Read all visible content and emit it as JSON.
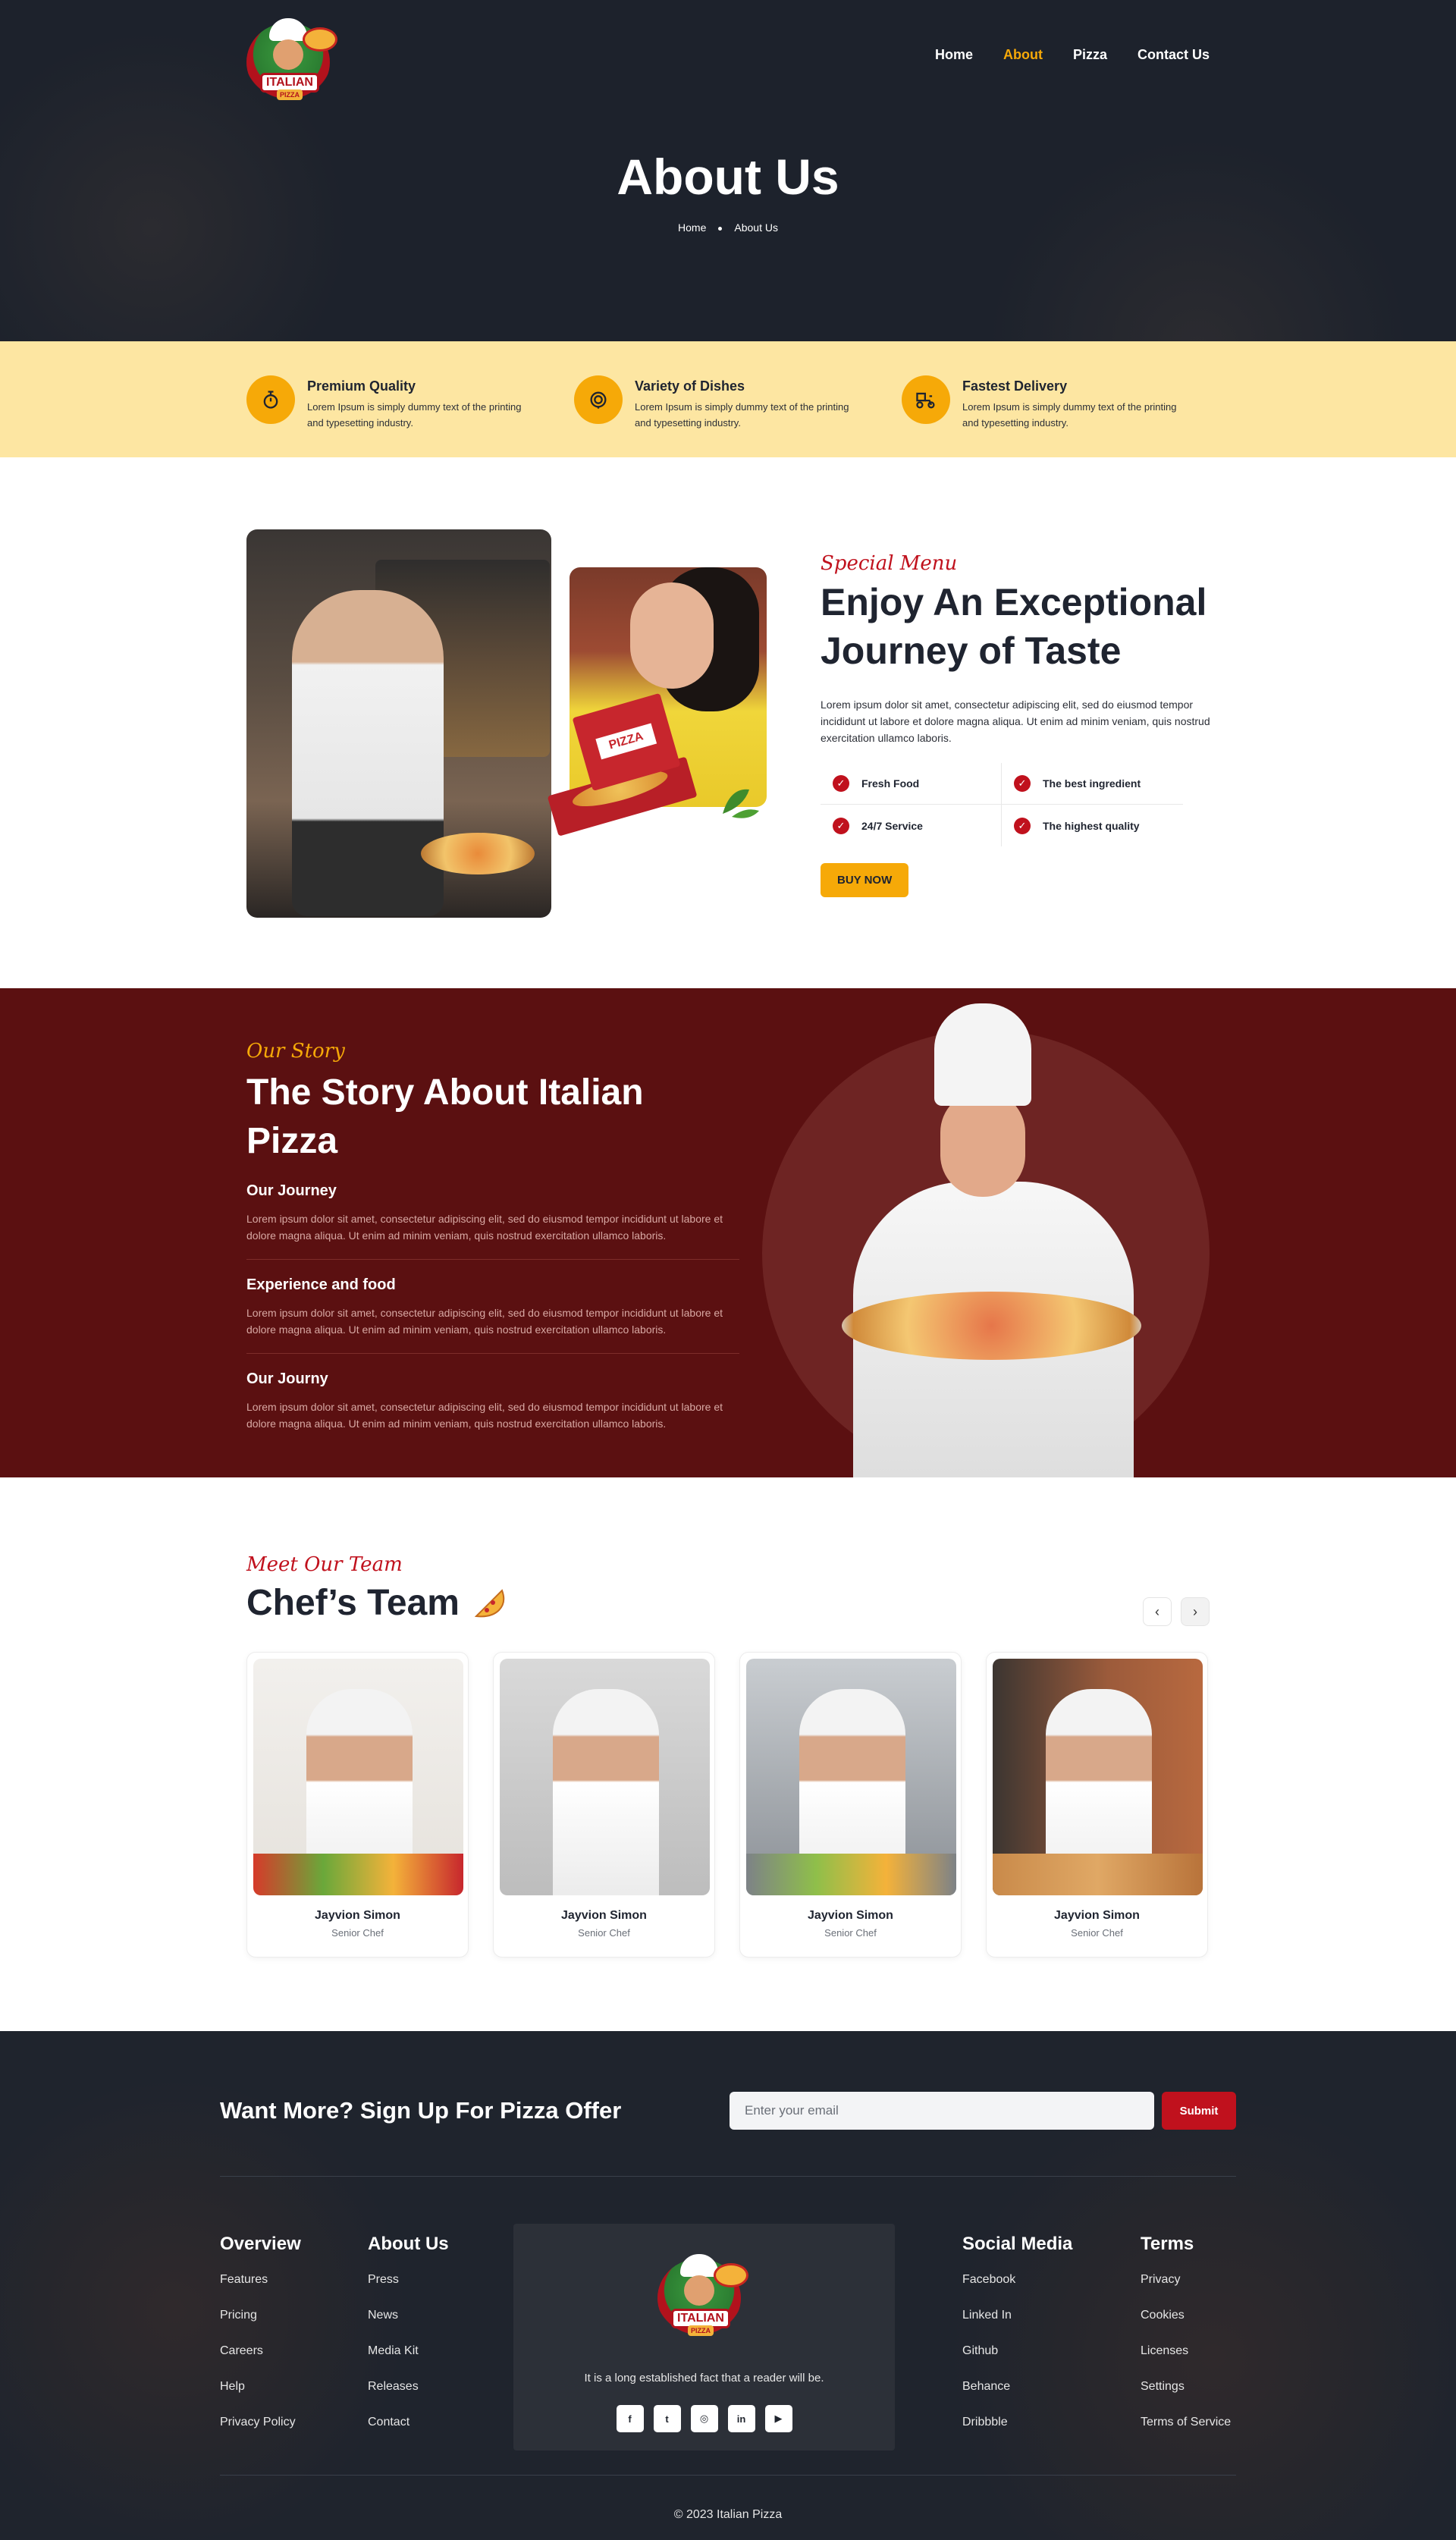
{
  "brand": {
    "logo_word": "ITALIAN",
    "logo_sub": "PIZZA"
  },
  "nav": {
    "items": [
      {
        "label": "Home",
        "active": false
      },
      {
        "label": "About",
        "active": true
      },
      {
        "label": "Pizza",
        "active": false
      },
      {
        "label": "Contact Us",
        "active": false
      }
    ]
  },
  "hero": {
    "title": "About Us",
    "breadcrumb": [
      "Home",
      "About Us"
    ]
  },
  "features": [
    {
      "title": "Premium Quality",
      "text": "Lorem Ipsum is simply dummy text of the printing and typesetting industry.",
      "icon": "stopwatch-icon"
    },
    {
      "title": "Variety of Dishes",
      "text": "Lorem Ipsum is simply dummy text of the printing and typesetting industry.",
      "icon": "dish-icon"
    },
    {
      "title": "Fastest Delivery",
      "text": "Lorem Ipsum is simply dummy text of the printing and typesetting industry.",
      "icon": "delivery-scooter-icon"
    }
  ],
  "about": {
    "tag": "Special Menu",
    "heading": "Enjoy An Exceptional Journey of Taste",
    "body": "Lorem ipsum dolor sit amet, consectetur adipiscing elit, sed do eiusmod tempor incididunt ut labore et dolore magna aliqua. Ut enim ad minim veniam, quis nostrud exercitation ullamco laboris.",
    "checks": [
      "Fresh Food",
      "The best ingredient",
      "24/7 Service",
      "The highest quality"
    ],
    "button": "BUY NOW",
    "box_label": "PIZZA"
  },
  "story": {
    "tag": "Our Story",
    "heading": "The Story About Italian Pizza",
    "items": [
      {
        "title": "Our Journey",
        "text": "Lorem ipsum dolor sit amet, consectetur adipiscing elit, sed do eiusmod tempor incididunt ut labore et dolore magna aliqua. Ut enim ad minim veniam, quis nostrud exercitation ullamco laboris."
      },
      {
        "title": "Experience and food",
        "text": "Lorem ipsum dolor sit amet, consectetur adipiscing elit, sed do eiusmod tempor incididunt ut labore et dolore magna aliqua. Ut enim ad minim veniam, quis nostrud exercitation ullamco laboris."
      },
      {
        "title": "Our Journy",
        "text": "Lorem ipsum dolor sit amet, consectetur adipiscing elit, sed do eiusmod tempor incididunt ut labore et dolore magna aliqua. Ut enim ad minim veniam, quis nostrud exercitation ullamco laboris."
      }
    ]
  },
  "team": {
    "tag": "Meet Our Team",
    "heading": "Chef’s Team",
    "prev": "‹",
    "next": "›",
    "members": [
      {
        "name": "Jayvion Simon",
        "role": "Senior Chef"
      },
      {
        "name": "Jayvion Simon",
        "role": "Senior Chef"
      },
      {
        "name": "Jayvion Simon",
        "role": "Senior Chef"
      },
      {
        "name": "Jayvion Simon",
        "role": "Senior Chef"
      }
    ]
  },
  "signup": {
    "heading": "Want More? Sign Up For Pizza Offer",
    "placeholder": "Enter your email",
    "button": "Submit"
  },
  "footer": {
    "overview": {
      "title": "Overview",
      "links": [
        "Features",
        "Pricing",
        "Careers",
        "Help",
        "Privacy Policy"
      ]
    },
    "about": {
      "title": "About Us",
      "links": [
        "Press",
        "News",
        "Media Kit",
        "Releases",
        "Contact"
      ]
    },
    "social": {
      "title": "Social Media",
      "links": [
        "Facebook",
        "Linked In",
        "Github",
        "Behance",
        "Dribbble"
      ]
    },
    "terms": {
      "title": "Terms",
      "links": [
        "Privacy",
        "Cookies",
        "Licenses",
        "Settings",
        "Terms of Service"
      ]
    },
    "tagline": "It is a long established fact that a reader will be.",
    "social_icons": [
      {
        "glyph": "f",
        "icon": "facebook-icon"
      },
      {
        "glyph": "t",
        "icon": "twitter-icon"
      },
      {
        "glyph": "◎",
        "icon": "instagram-icon"
      },
      {
        "glyph": "in",
        "icon": "linkedin-icon"
      },
      {
        "glyph": "▶",
        "icon": "youtube-icon"
      }
    ],
    "copyright": "© 2023 Italian Pizza"
  },
  "colors": {
    "dark": "#1d222c",
    "accent": "#f6a908",
    "red": "#c0111d",
    "maroon": "#5b1011",
    "cream": "#fde6a2"
  }
}
